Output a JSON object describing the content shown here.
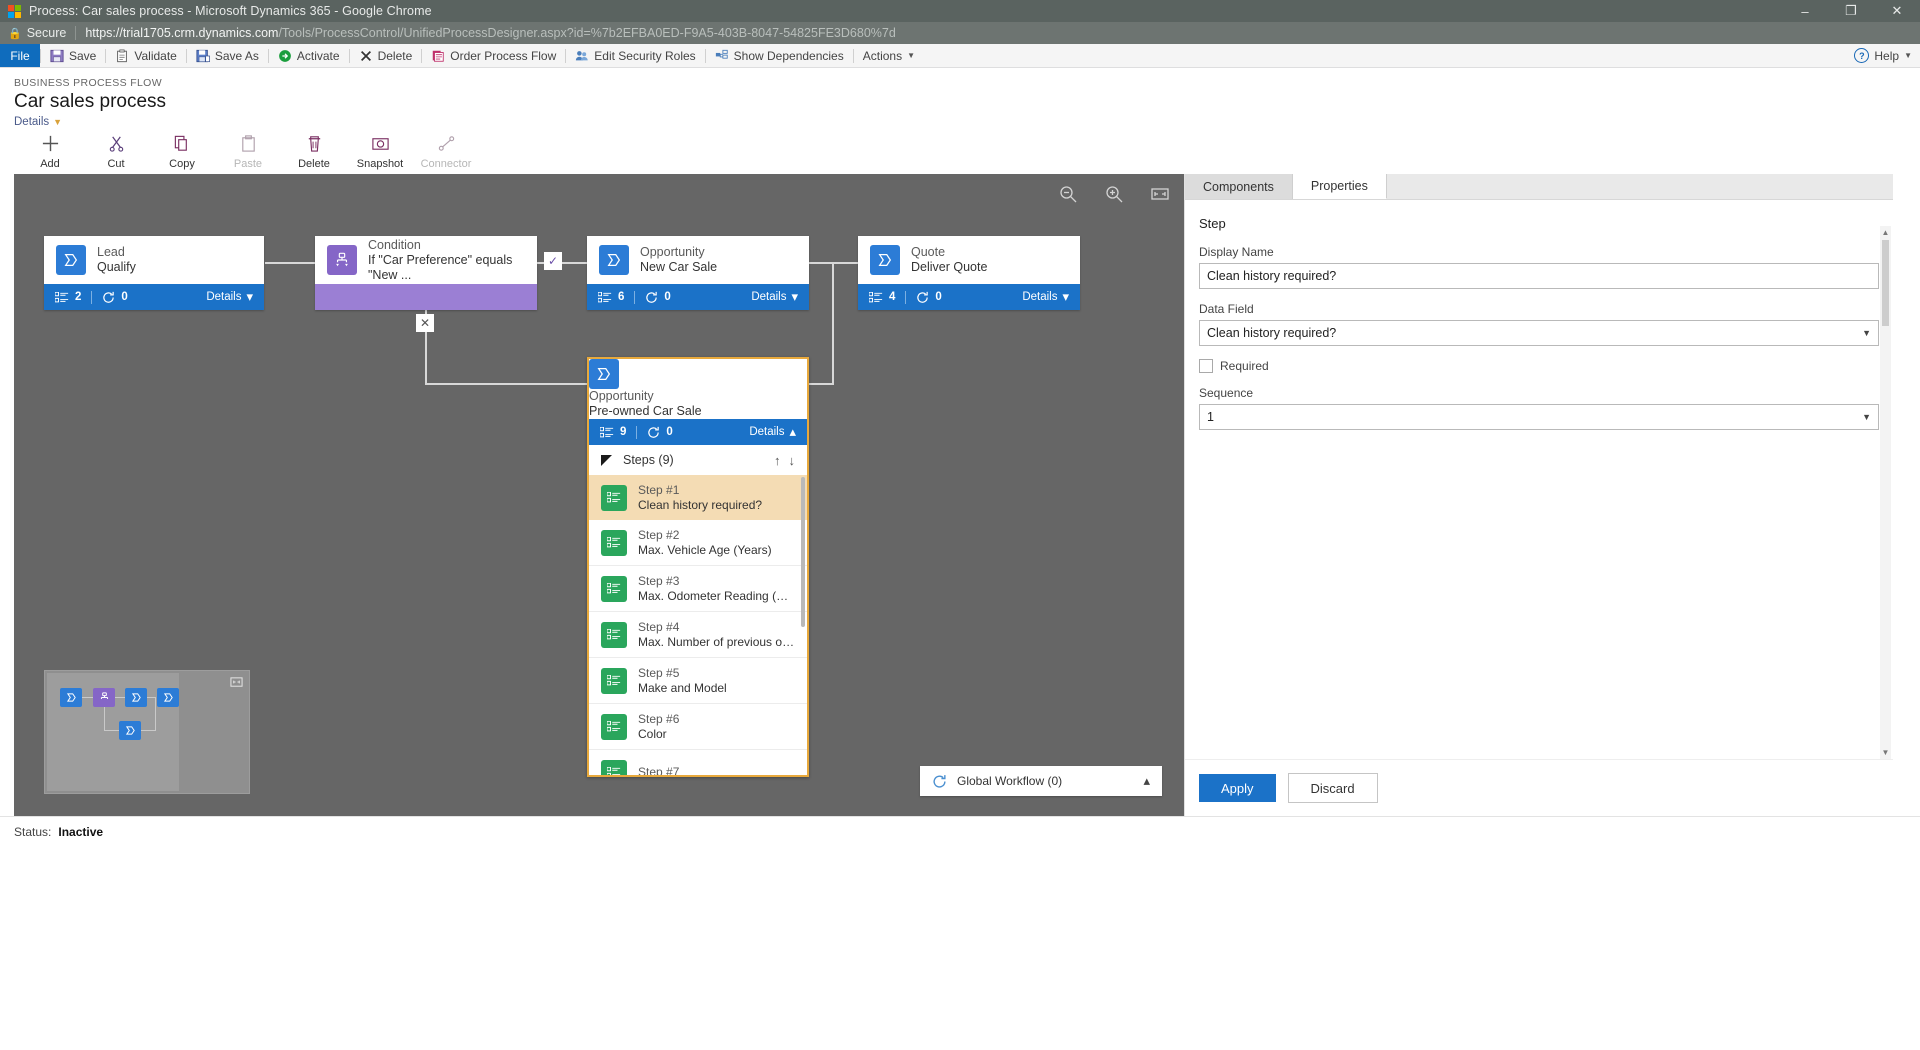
{
  "window": {
    "title": "Process: Car sales process - Microsoft Dynamics 365 - Google Chrome",
    "minimize": "–",
    "maximize": "❐",
    "close": "✕"
  },
  "address": {
    "secure_label": "Secure",
    "url_domain": "https://trial1705.crm.dynamics.com",
    "url_path": "/Tools/ProcessControl/UnifiedProcessDesigner.aspx?id=%7b2EFBA0ED-F9A5-403B-8047-54825FE3D680%7d"
  },
  "commandbar": {
    "file": "File",
    "items": [
      {
        "label": "Save",
        "icon": "save-icon"
      },
      {
        "label": "Validate",
        "icon": "validate-icon"
      },
      {
        "label": "Save As",
        "icon": "save-as-icon"
      },
      {
        "label": "Activate",
        "icon": "activate-icon"
      },
      {
        "label": "Delete",
        "icon": "delete-icon"
      },
      {
        "label": "Order Process Flow",
        "icon": "order-process-flow-icon"
      },
      {
        "label": "Edit Security Roles",
        "icon": "edit-security-roles-icon"
      },
      {
        "label": "Show Dependencies",
        "icon": "show-dependencies-icon"
      },
      {
        "label": "Actions",
        "icon": "actions-icon"
      }
    ],
    "help": "Help"
  },
  "header": {
    "breadcrumb": "BUSINESS PROCESS FLOW",
    "title": "Car sales process",
    "details_link": "Details"
  },
  "designer_toolbar": [
    {
      "label": "Add",
      "icon": "plus-icon",
      "disabled": false
    },
    {
      "label": "Cut",
      "icon": "scissors-icon",
      "disabled": false
    },
    {
      "label": "Copy",
      "icon": "copy-icon",
      "disabled": false
    },
    {
      "label": "Paste",
      "icon": "paste-icon",
      "disabled": true
    },
    {
      "label": "Delete",
      "icon": "trash-icon",
      "disabled": false
    },
    {
      "label": "Snapshot",
      "icon": "camera-icon",
      "disabled": false
    },
    {
      "label": "Connector",
      "icon": "connector-icon",
      "disabled": true
    }
  ],
  "canvas": {
    "zoom_out": "zoom-out-icon",
    "zoom_in": "zoom-in-icon",
    "fit": "fit-to-screen-icon",
    "stages": [
      {
        "entity": "Lead",
        "name": "Qualify",
        "steps_count": "2",
        "loops_count": "0",
        "details": "Details",
        "chevron": "⌄"
      },
      {
        "entity": "Condition",
        "name": "If \"Car Preference\" equals \"New ...",
        "is_condition": true,
        "check": "✓",
        "cross": "✕"
      },
      {
        "entity": "Opportunity",
        "name": "New Car Sale",
        "steps_count": "6",
        "loops_count": "0",
        "details": "Details",
        "chevron": "⌄"
      },
      {
        "entity": "Quote",
        "name": "Deliver Quote",
        "steps_count": "4",
        "loops_count": "0",
        "details": "Details",
        "chevron": "⌄"
      }
    ],
    "selected_stage": {
      "entity": "Opportunity",
      "name": "Pre-owned Car Sale",
      "steps_count": "9",
      "loops_count": "0",
      "details": "Details",
      "chevron": "⌃",
      "steps_header": "Steps (9)",
      "move_up": "↑",
      "move_down": "↓",
      "steps": [
        {
          "index": "Step #1",
          "label": "Clean history required?",
          "selected": true
        },
        {
          "index": "Step #2",
          "label": "Max. Vehicle Age (Years)",
          "selected": false
        },
        {
          "index": "Step #3",
          "label": "Max. Odometer Reading (Max)",
          "selected": false
        },
        {
          "index": "Step #4",
          "label": "Max. Number of previous ow...",
          "selected": false
        },
        {
          "index": "Step #5",
          "label": "Make and Model",
          "selected": false
        },
        {
          "index": "Step #6",
          "label": "Color",
          "selected": false
        },
        {
          "index": "Step #7",
          "label": "",
          "selected": false
        }
      ]
    },
    "global_workflow": {
      "label": "Global Workflow (0)",
      "icon": "refresh-icon",
      "chevron": "⌃"
    }
  },
  "properties": {
    "tab_components": "Components",
    "tab_properties": "Properties",
    "section_title": "Step",
    "display_name_label": "Display Name",
    "display_name_value": "Clean history required?",
    "data_field_label": "Data Field",
    "data_field_value": "Clean history required?",
    "required_label": "Required",
    "sequence_label": "Sequence",
    "sequence_value": "1",
    "dropdown_arrow": "▾",
    "apply": "Apply",
    "discard": "Discard"
  },
  "statusbar": {
    "label": "Status:",
    "value": "Inactive"
  },
  "colors": {
    "accent_blue": "#1b72c8",
    "stage_purple": "#8566c7",
    "step_green": "#2aa65c",
    "selection_orange": "#e8a93c",
    "canvas_gray": "#666666"
  }
}
